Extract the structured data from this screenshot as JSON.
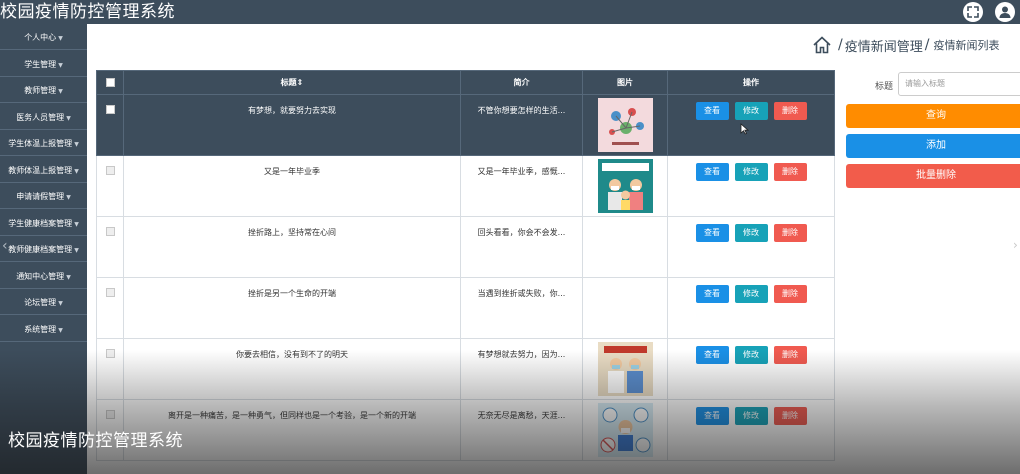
{
  "app": {
    "title": "校园疫情防控管理系统"
  },
  "sidebar": {
    "items": [
      {
        "label": "个人中心"
      },
      {
        "label": "学生管理"
      },
      {
        "label": "教师管理"
      },
      {
        "label": "医务人员管理"
      },
      {
        "label": "学生体温上报管理"
      },
      {
        "label": "教师体温上报管理"
      },
      {
        "label": "申请请假管理"
      },
      {
        "label": "学生健康档案管理"
      },
      {
        "label": "教师健康档案管理"
      },
      {
        "label": "通知中心管理"
      },
      {
        "label": "论坛管理"
      },
      {
        "label": "系统管理"
      }
    ],
    "caret": "▼"
  },
  "breadcrumb": {
    "separator": "/",
    "section": "疫情新闻管理",
    "current": "疫情新闻列表"
  },
  "table": {
    "headers": {
      "title": "标题",
      "sort_mark": "⇕",
      "summary": "简介",
      "image": "图片",
      "actions": "操作"
    },
    "rows": [
      {
        "title": "有梦想，就要努力去实现",
        "summary": "不管你想要怎样的生活...",
        "image": "chemistry-poster",
        "selected": true
      },
      {
        "title": "又是一年毕业季",
        "summary": "又是一年毕业季，感慨...",
        "image": "family-mask-poster",
        "selected": false
      },
      {
        "title": "挫折路上，坚持常在心间",
        "summary": "回头看看，你会不会发...",
        "image": "",
        "selected": false
      },
      {
        "title": "挫折是另一个生命的开端",
        "summary": "当遇到挫折或失败，你...",
        "image": "",
        "selected": false
      },
      {
        "title": "你要去相信，没有到不了的明天",
        "summary": "有梦想就去努力，因为...",
        "image": "doctors-poster",
        "selected": false
      },
      {
        "title": "离开是一种痛苦，是一种勇气，但同样也是一个考验，是一个新的开端",
        "summary": "无奈无尽是离愁，天涯...",
        "image": "protection-poster",
        "selected": false
      }
    ],
    "buttons": {
      "view": "查看",
      "edit": "修改",
      "delete": "删除"
    }
  },
  "search": {
    "label": "标题",
    "placeholder": "请输入标题"
  },
  "actions": {
    "query": "查询",
    "add": "添加",
    "bulk_delete": "批量删除"
  },
  "overlay_caption": "校园疫情防控管理系统",
  "colors": {
    "nav": "#3d4d5c",
    "view": "#1a90e6",
    "edit": "#17a2b8",
    "delete": "#f05a50",
    "query": "#ff8c00",
    "bulk_delete": "#f25c4b"
  }
}
